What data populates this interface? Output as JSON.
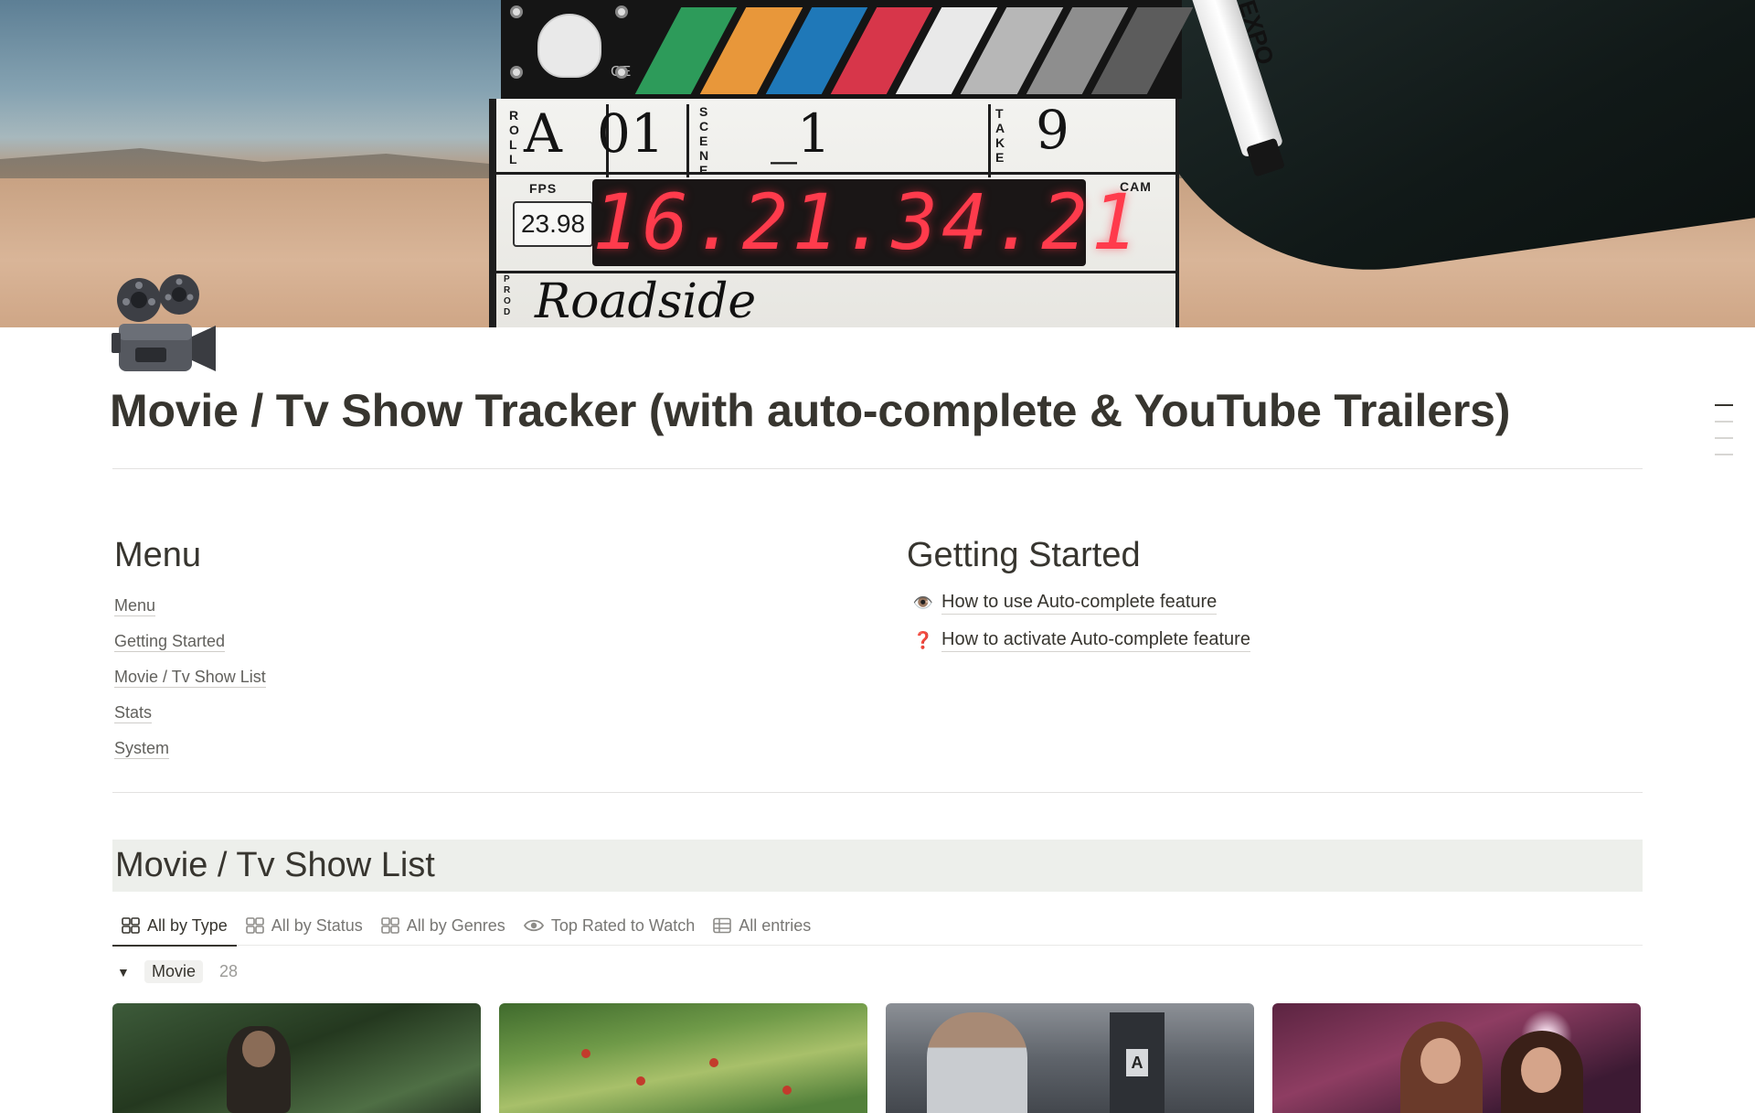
{
  "cover": {
    "slate": {
      "roll": "A",
      "scene": "01",
      "shot": "_1",
      "take": "9",
      "fps": "23.98",
      "timecode": "16.21.34.21",
      "production": "Roadside",
      "marker_brand": "EXPO",
      "labels": {
        "roll": "ROLL",
        "scene": "SCENE",
        "take": "TAKE",
        "fps": "FPS",
        "cam": "CAM",
        "prod": "PROD"
      },
      "stripe_colors": [
        "#2d9b5a",
        "#e8973a",
        "#1f78b8",
        "#d7364a",
        "#e9e9e9",
        "#b7b7b7",
        "#8e8e8e",
        "#5c5c5c"
      ]
    }
  },
  "page": {
    "icon": "movie-camera-icon",
    "title": "Movie / Tv Show Tracker (with auto-complete & YouTube Trailers)"
  },
  "menu": {
    "heading": "Menu",
    "links": [
      "Menu",
      "Getting Started",
      "Movie / Tv Show List",
      "Stats",
      "System"
    ]
  },
  "getting_started": {
    "heading": "Getting Started",
    "links": [
      {
        "emoji": "👁️",
        "label": "How to use Auto-complete feature"
      },
      {
        "emoji": "❓",
        "label": "How to activate Auto-complete feature"
      }
    ]
  },
  "list": {
    "heading": "Movie / Tv Show List",
    "tabs": [
      {
        "label": "All by Type",
        "icon": "board-icon",
        "active": true
      },
      {
        "label": "All by Status",
        "icon": "board-icon",
        "active": false
      },
      {
        "label": "All by Genres",
        "icon": "board-icon",
        "active": false
      },
      {
        "label": "Top Rated to Watch",
        "icon": "eye-icon",
        "active": false
      },
      {
        "label": "All entries",
        "icon": "table-icon",
        "active": false
      }
    ],
    "group": {
      "toggle": "▼",
      "name": "Movie",
      "count": "28"
    }
  },
  "colors": {
    "text": "#37352f",
    "muted": "#787774",
    "list_header_bg": "#edefeb",
    "divider": "#e3e2e0"
  }
}
